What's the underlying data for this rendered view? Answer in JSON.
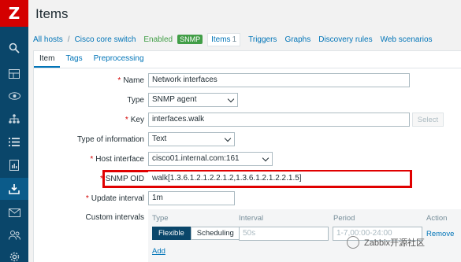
{
  "app": {
    "logo_letter": "Z"
  },
  "sidebar": {
    "icons": [
      {
        "name": "search-icon",
        "glyph": "⌕"
      },
      {
        "name": "dashboard-icon",
        "glyph": "▦"
      },
      {
        "name": "monitoring-eye-icon",
        "glyph": "◉"
      },
      {
        "name": "network-icon",
        "glyph": "⁂"
      },
      {
        "name": "list-icon",
        "glyph": "☰"
      },
      {
        "name": "reports-icon",
        "glyph": "▥"
      },
      {
        "name": "data-collection-icon",
        "glyph": "⇩"
      },
      {
        "name": "mail-icon",
        "glyph": "✉"
      },
      {
        "name": "users-icon",
        "glyph": "⚇"
      },
      {
        "name": "settings-icon",
        "glyph": "⚙"
      }
    ]
  },
  "header": {
    "title": "Items"
  },
  "nav": {
    "all_hosts": "All hosts",
    "sep": "/",
    "host": "Cisco core switch",
    "status": "Enabled",
    "badge": "SNMP",
    "items_label": "Items",
    "items_count": "1",
    "triggers": "Triggers",
    "graphs": "Graphs",
    "discovery": "Discovery rules",
    "web": "Web scenarios"
  },
  "form_tabs": {
    "item": "Item",
    "tags": "Tags",
    "preprocessing": "Preprocessing"
  },
  "form": {
    "name": {
      "label": "Name",
      "value": "Network interfaces"
    },
    "type": {
      "label": "Type",
      "value": "SNMP agent"
    },
    "key": {
      "label": "Key",
      "value": "interfaces.walk",
      "button": "Select"
    },
    "type_of_info": {
      "label": "Type of information",
      "value": "Text"
    },
    "host_interface": {
      "label": "Host interface",
      "value": "cisco01.internal.com:161"
    },
    "snmp_oid": {
      "label": "SNMP OID",
      "value": "walk[1.3.6.1.2.1.2.2.1.2,1.3.6.1.2.1.2.2.1.5]"
    },
    "update_interval": {
      "label": "Update interval",
      "value": "1m"
    },
    "custom_intervals": {
      "label": "Custom intervals",
      "headers": {
        "type": "Type",
        "interval": "Interval",
        "period": "Period",
        "action": "Action"
      },
      "flexible": "Flexible",
      "scheduling": "Scheduling",
      "interval_placeholder": "50s",
      "period_placeholder": "1-7,00:00-24:00",
      "remove": "Remove",
      "add": "Add"
    }
  },
  "watermark": "Zabbix开源社区",
  "colors": {
    "sidebar": "#0a466a",
    "logo": "#d40000",
    "link": "#0275b8",
    "highlight": "#e00000",
    "enabled": "#429e47"
  }
}
